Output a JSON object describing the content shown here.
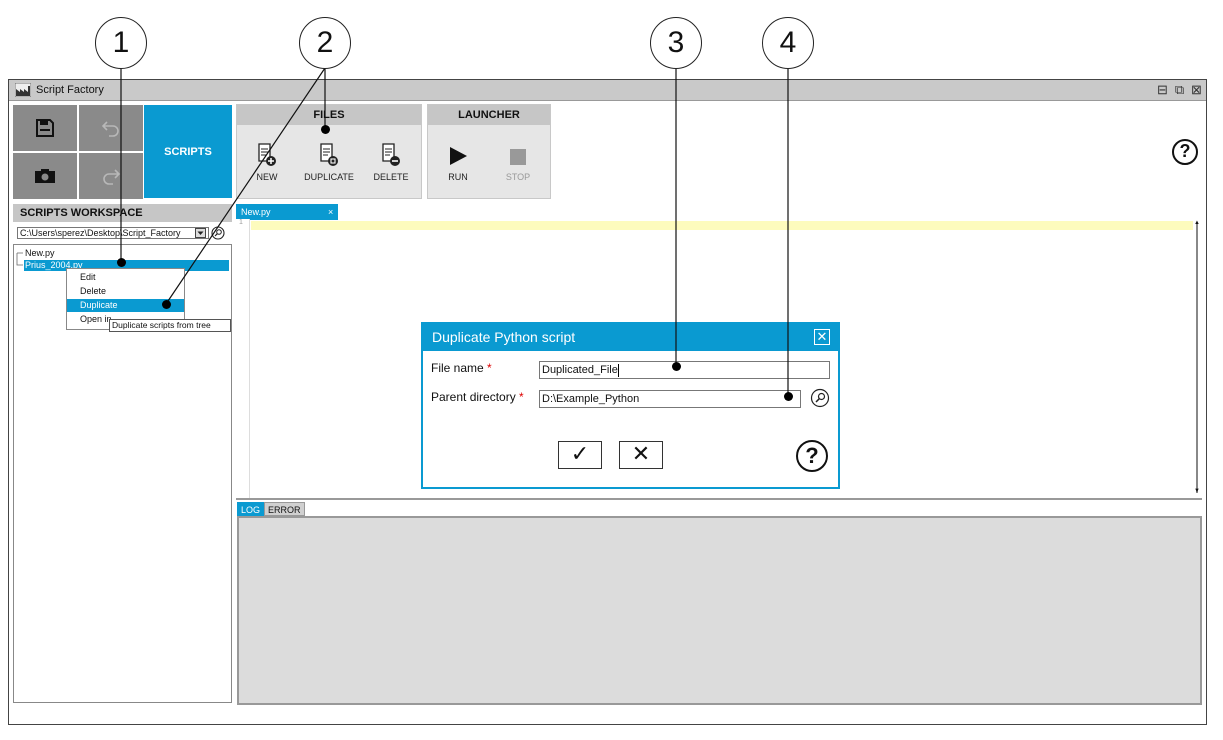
{
  "callouts": [
    "1",
    "2",
    "3",
    "4"
  ],
  "window": {
    "title": "Script Factory",
    "controls": [
      "⊟",
      "⧉",
      "⊠"
    ]
  },
  "toolbar": {
    "scripts_label": "SCRIPTS",
    "files_group": {
      "title": "FILES",
      "new_label": "NEW",
      "duplicate_label": "DUPLICATE",
      "delete_label": "DELETE"
    },
    "launcher_group": {
      "title": "LAUNCHER",
      "run_label": "RUN",
      "stop_label": "STOP"
    },
    "help_glyph": "?"
  },
  "workspace": {
    "title": "SCRIPTS WORKSPACE",
    "path": "C:\\Users\\sperez\\Desktop\\Script_Factory",
    "tree": [
      "New.py",
      "Prius_2004.py"
    ]
  },
  "context_menu": {
    "items": [
      "Edit",
      "Delete",
      "Duplicate",
      "Open in"
    ],
    "selected": "Duplicate",
    "tooltip": "Duplicate scripts from tree"
  },
  "editor": {
    "tab_label": "New.py",
    "tab_close": "×",
    "line_number": "1"
  },
  "log": {
    "tabs": [
      "LOG",
      "ERROR"
    ],
    "active": "LOG"
  },
  "dialog": {
    "title": "Duplicate Python script",
    "close_glyph": "✕",
    "file_name_label": "File name",
    "file_name_value": "Duplicated_File",
    "parent_dir_label": "Parent directory",
    "parent_dir_value": "D:\\Example_Python",
    "required_mark": "*",
    "ok_glyph": "✓",
    "cancel_glyph": "✕",
    "help_glyph": "?"
  },
  "colors": {
    "accent": "#0a9ad1",
    "toolbar_gray": "#8a8a8a",
    "highlight_line": "#fdfbbd"
  }
}
